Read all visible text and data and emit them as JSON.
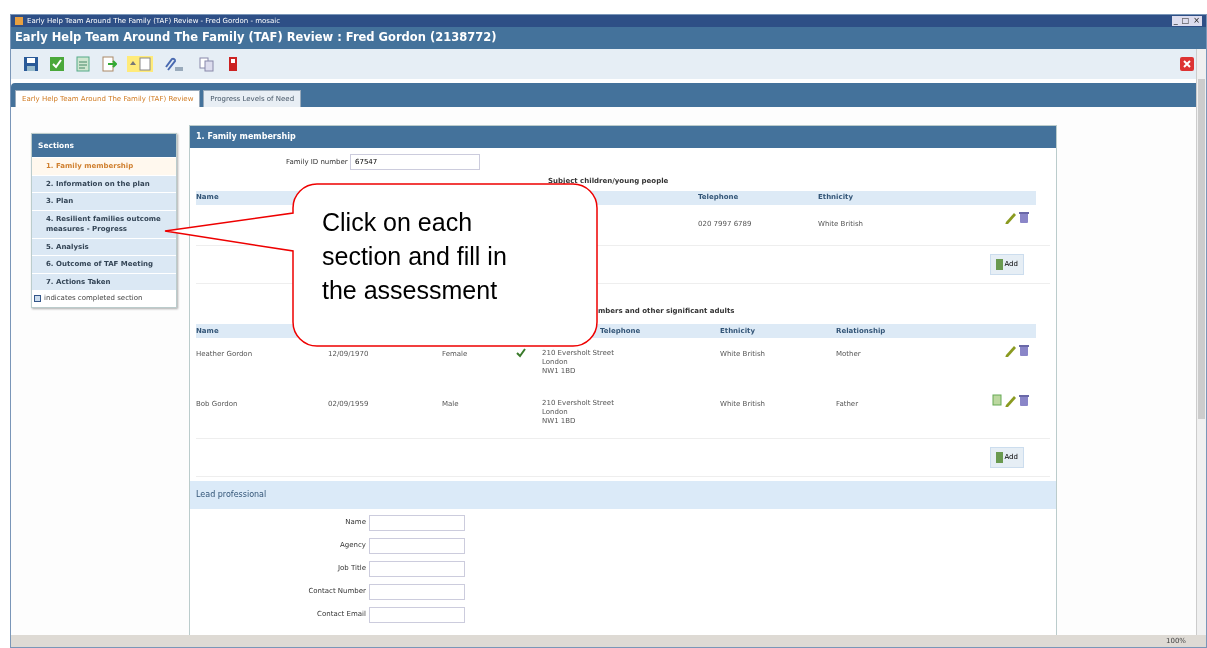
{
  "window": {
    "caption": "Early Help Team Around The Family (TAF) Review - Fred Gordon - mosaic",
    "controls": [
      "_",
      "□",
      "×"
    ]
  },
  "form_title": "Early Help Team Around The Family (TAF) Review : Fred Gordon (2138772)",
  "tabs": [
    {
      "label": "Early Help Team Around The Family (TAF) Review",
      "selected": true
    },
    {
      "label": "Progress Levels of Need",
      "selected": false
    }
  ],
  "sidebar": {
    "title": "Sections",
    "items": [
      {
        "label": "1. Family membership",
        "selected": true
      },
      {
        "label": "2. Information on the plan",
        "selected": false
      },
      {
        "label": "3. Plan",
        "selected": false
      },
      {
        "label": "4. Resilient families outcome measures - Progress",
        "selected": false
      },
      {
        "label": "5. Analysis",
        "selected": false
      },
      {
        "label": "6. Outcome of TAF Meeting",
        "selected": false
      },
      {
        "label": "7. Actions Taken",
        "selected": false
      }
    ],
    "legend": "indicates completed section"
  },
  "panel": {
    "title": "1. Family membership",
    "family_id": {
      "label": "Family ID number",
      "value": "67547"
    },
    "children": {
      "heading": "Subject children/young people",
      "columns": [
        "Name",
        "Telephone",
        "Ethnicity"
      ],
      "rows": [
        {
          "telephone": "020 7997 6789",
          "ethnicity": "White British"
        }
      ],
      "add": "Add"
    },
    "adults": {
      "heading": "mbers and other significant adults",
      "columns": [
        "Name",
        "Telephone",
        "Ethnicity",
        "Relationship"
      ],
      "rows": [
        {
          "name": "Heather Gordon",
          "dob": "12/09/1970",
          "gender": "Female",
          "main_carer": true,
          "address": [
            "210 Eversholt Street",
            "London",
            "NW1 1BD"
          ],
          "ethnicity": "White British",
          "relationship": "Mother",
          "has_document": false
        },
        {
          "name": "Bob Gordon",
          "dob": "02/09/1959",
          "gender": "Male",
          "main_carer": false,
          "address": [
            "210 Eversholt Street",
            "London",
            "NW1 1BD"
          ],
          "ethnicity": "White British",
          "relationship": "Father",
          "has_document": true
        }
      ],
      "add": "Add"
    },
    "lead_professional": {
      "title": "Lead professional",
      "fields": [
        "Name",
        "Agency",
        "Job Title",
        "Contact Number",
        "Contact Email"
      ]
    }
  },
  "callout": {
    "text": "Click on each section and fill in the assessment"
  },
  "status_bar": {
    "zoom": "100%"
  }
}
